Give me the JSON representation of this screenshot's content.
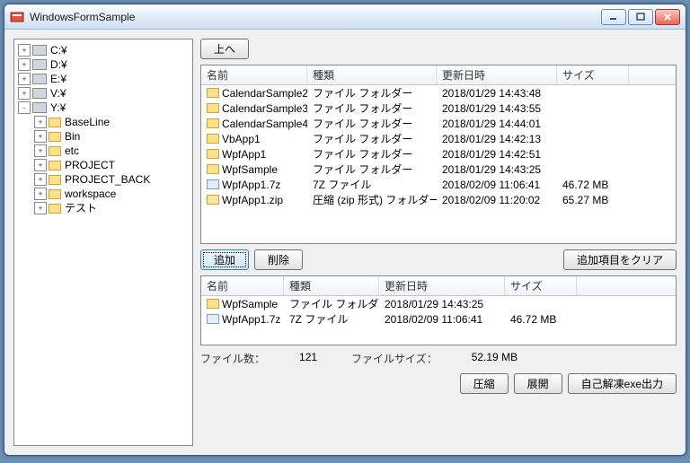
{
  "window": {
    "title": "WindowsFormSample"
  },
  "tree": {
    "drives": [
      {
        "label": "C:¥",
        "expand": "+"
      },
      {
        "label": "D:¥",
        "expand": "+"
      },
      {
        "label": "E:¥",
        "expand": "+"
      },
      {
        "label": "V:¥",
        "expand": "+"
      },
      {
        "label": "Y:¥",
        "expand": "-"
      }
    ],
    "y_children": [
      {
        "label": "BaseLine"
      },
      {
        "label": "Bin"
      },
      {
        "label": "etc"
      },
      {
        "label": "PROJECT"
      },
      {
        "label": "PROJECT_BACK"
      },
      {
        "label": "workspace"
      },
      {
        "label": "テスト"
      }
    ]
  },
  "buttons": {
    "up": "上へ",
    "add": "追加",
    "remove": "削除",
    "clear_added": "追加項目をクリア",
    "compress": "圧縮",
    "extract": "展開",
    "sfx": "自己解凍exe出力"
  },
  "mainlist": {
    "headers": {
      "name": "名前",
      "type": "種類",
      "date": "更新日時",
      "size": "サイズ"
    },
    "rows": [
      {
        "icon": "folder",
        "name": "CalendarSample2",
        "type": "ファイル フォルダー",
        "date": "2018/01/29 14:43:48",
        "size": ""
      },
      {
        "icon": "folder",
        "name": "CalendarSample3",
        "type": "ファイル フォルダー",
        "date": "2018/01/29 14:43:55",
        "size": ""
      },
      {
        "icon": "folder",
        "name": "CalendarSample4",
        "type": "ファイル フォルダー",
        "date": "2018/01/29 14:44:01",
        "size": ""
      },
      {
        "icon": "folder",
        "name": "VbApp1",
        "type": "ファイル フォルダー",
        "date": "2018/01/29 14:42:13",
        "size": ""
      },
      {
        "icon": "folder",
        "name": "WpfApp1",
        "type": "ファイル フォルダー",
        "date": "2018/01/29 14:42:51",
        "size": ""
      },
      {
        "icon": "folder",
        "name": "WpfSample",
        "type": "ファイル フォルダー",
        "date": "2018/01/29 14:43:25",
        "size": ""
      },
      {
        "icon": "sevenz",
        "name": "WpfApp1.7z",
        "type": "7Z ファイル",
        "date": "2018/02/09 11:06:41",
        "size": "46.72 MB"
      },
      {
        "icon": "zip",
        "name": "WpfApp1.zip",
        "type": "圧縮 (zip 形式) フォルダー",
        "date": "2018/02/09 11:20:02",
        "size": "65.27 MB"
      }
    ]
  },
  "addedlist": {
    "headers": {
      "name": "名前",
      "type": "種類",
      "date": "更新日時",
      "size": "サイズ"
    },
    "rows": [
      {
        "icon": "folder",
        "name": "WpfSample",
        "type": "ファイル フォルダー",
        "date": "2018/01/29 14:43:25",
        "size": ""
      },
      {
        "icon": "sevenz",
        "name": "WpfApp1.7z",
        "type": "7Z ファイル",
        "date": "2018/02/09 11:06:41",
        "size": "46.72 MB"
      }
    ]
  },
  "stats": {
    "filecount_label": "ファイル数：",
    "filecount_value": "121",
    "filesize_label": "ファイルサイズ：",
    "filesize_value": "52.19 MB"
  }
}
